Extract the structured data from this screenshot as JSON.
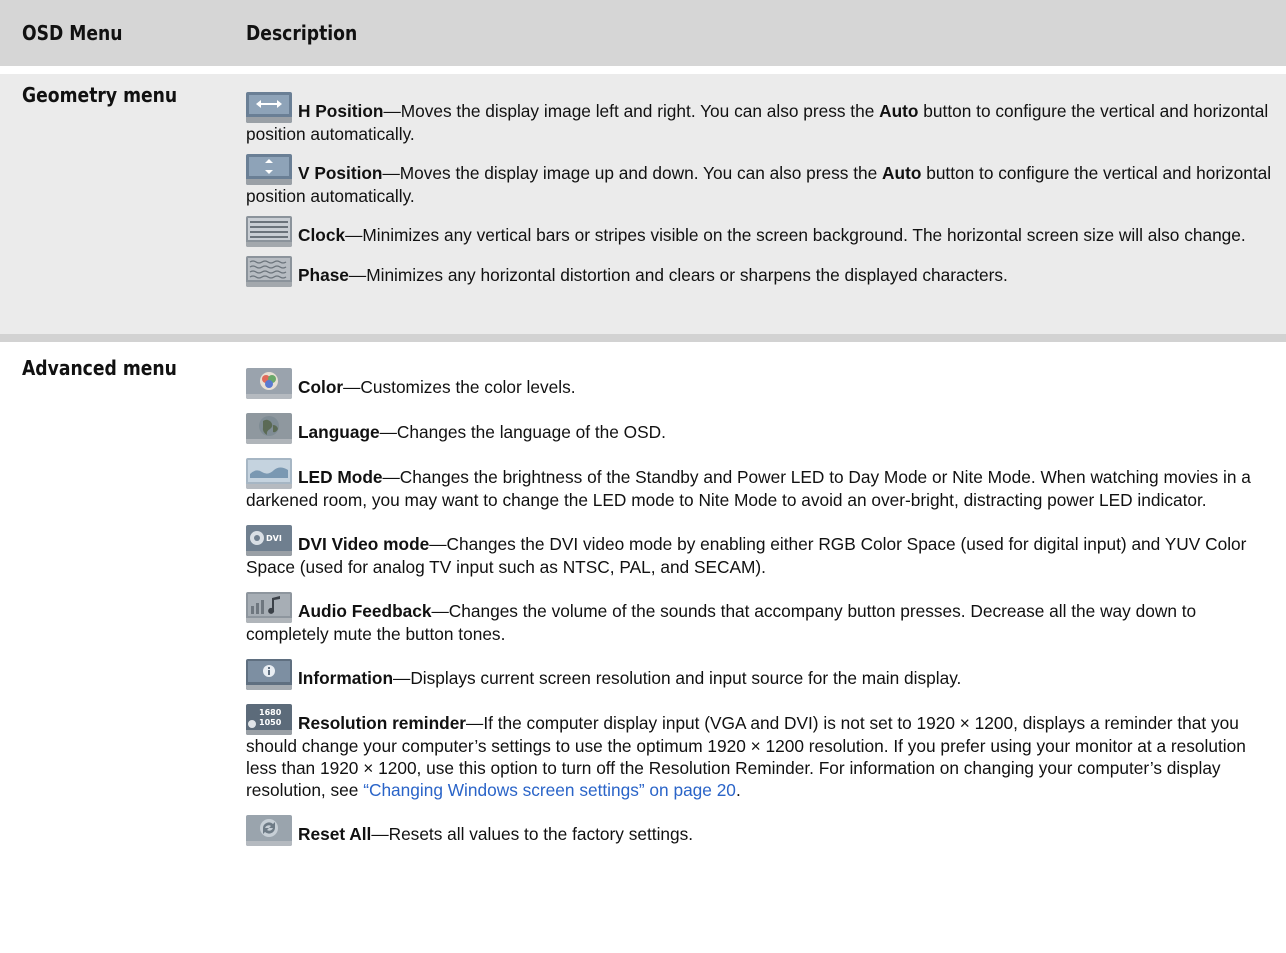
{
  "header": {
    "col1": "OSD Menu",
    "col2": "Description"
  },
  "geometry": {
    "label": "Geometry menu",
    "items": [
      {
        "icon": "h-position-icon",
        "title": "H Position",
        "text": "—Moves the display image left and right. You can also press the ",
        "bold2": "Auto",
        "text2": " button to configure the vertical and horizontal position automatically."
      },
      {
        "icon": "v-position-icon",
        "title": "V Position",
        "text": "—Moves the display image up and down. You can also press the ",
        "bold2": "Auto",
        "text2": " button to configure the vertical and horizontal position automatically."
      },
      {
        "icon": "clock-icon",
        "title": "Clock",
        "text": "—Minimizes any vertical bars or stripes visible on the screen background. The horizontal screen size will also change."
      },
      {
        "icon": "phase-icon",
        "title": "Phase",
        "text": "—Minimizes any horizontal distortion and clears or sharpens the displayed characters."
      }
    ]
  },
  "advanced": {
    "label": "Advanced menu",
    "items": [
      {
        "icon": "color-icon",
        "title": "Color",
        "text": "—Customizes the color levels."
      },
      {
        "icon": "language-icon",
        "title": "Language",
        "text": "—Changes the language of the OSD."
      },
      {
        "icon": "led-mode-icon",
        "title": "LED Mode",
        "text": "—Changes the brightness of the Standby and Power LED to Day Mode or Nite Mode. When watching movies in a darkened room, you may want to change the LED mode to Nite Mode to avoid an over-bright, distracting power LED indicator."
      },
      {
        "icon": "dvi-video-mode-icon",
        "title": "DVI Video mode",
        "text": "—Changes the DVI video mode by enabling either RGB Color Space (used for digital input) and YUV Color Space (used for analog TV input such as NTSC, PAL, and SECAM)."
      },
      {
        "icon": "audio-feedback-icon",
        "title": "Audio Feedback",
        "text": "—Changes the volume of the sounds that accompany button presses. Decrease all the way down to completely mute the button tones."
      },
      {
        "icon": "information-icon",
        "title": "Information",
        "text": "—Displays current screen resolution and input source for the main display."
      },
      {
        "icon": "resolution-reminder-icon",
        "title": "Resolution reminder",
        "text": "—If the computer display input (VGA and DVI) is not set to 1920 × 1200, displays a reminder that you should change your computer’s settings to use the optimum 1920 × 1200 resolution. If you prefer using your monitor at a resolution less than 1920 × 1200, use this option to turn off the Resolution Reminder. For information on changing your computer’s display resolution, see ",
        "link": "“Changing Windows screen settings” on page 20",
        "text2": "."
      },
      {
        "icon": "reset-all-icon",
        "title": "Reset All",
        "text": "—Resets all values to the factory settings."
      }
    ]
  },
  "colors": {
    "header_bg": "#d6d6d6",
    "geometry_bg": "#ebebeb",
    "link": "#2a64c8"
  }
}
